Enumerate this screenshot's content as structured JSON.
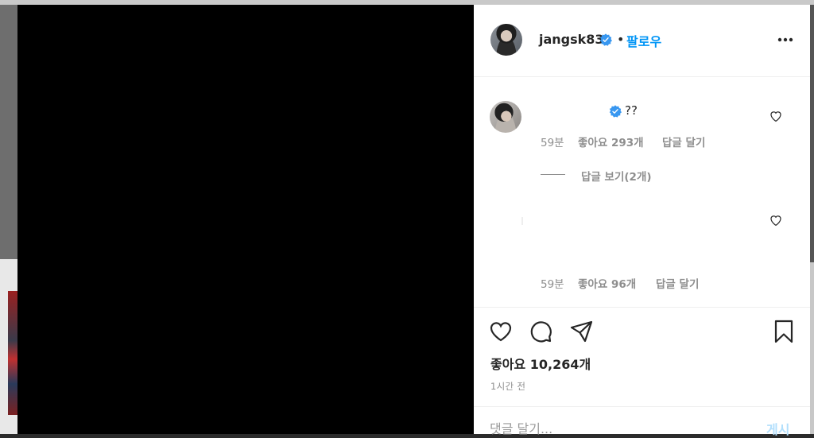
{
  "header": {
    "username": "jangsk83",
    "separator": "•",
    "follow_label": "팔로우",
    "avatar_icon": "profile-avatar",
    "more_icon": "more-horizontal-icon",
    "verified_icon": "verified-badge-icon"
  },
  "comments": [
    {
      "text": "??",
      "time": "59분",
      "likes": "좋아요 293개",
      "reply": "답글 달기",
      "view_replies": "답글 보기(2개)"
    },
    {
      "time": "59분",
      "likes": "좋아요 96개",
      "reply": "답글 달기"
    }
  ],
  "post": {
    "like_count": "좋아요 10,264개",
    "time_ago": "1시간 전"
  },
  "composer": {
    "placeholder": "댓글 달기...",
    "post_label": "게시"
  },
  "colors": {
    "accent": "#0095f6",
    "text": "#262626",
    "muted": "#8e8e8e",
    "post_disabled": "#b2dffc"
  }
}
